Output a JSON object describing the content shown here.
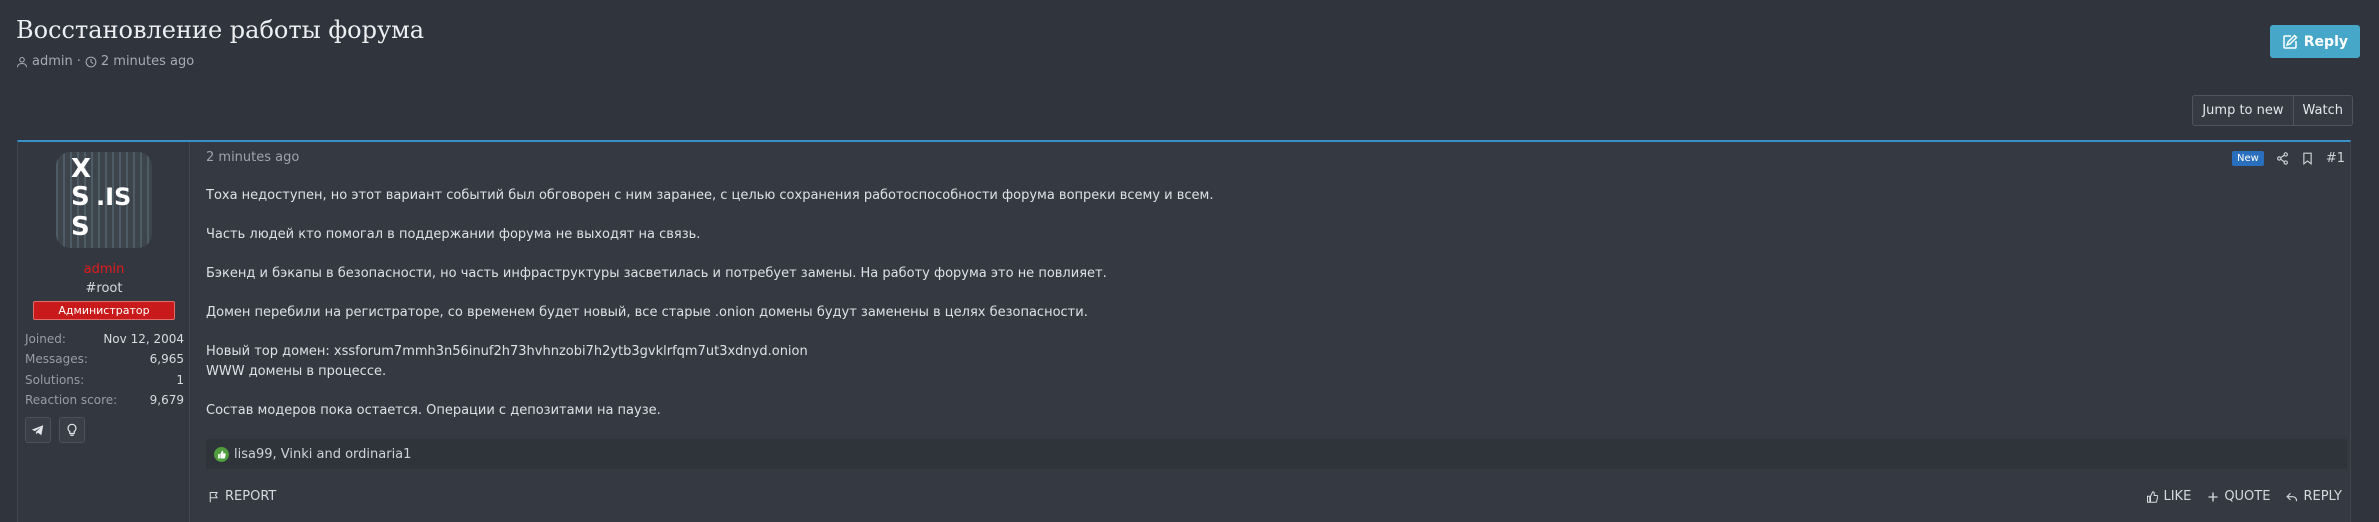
{
  "thread": {
    "title": "Восстановление работы форума",
    "author": "admin",
    "separator": "·",
    "time": "2 minutes ago"
  },
  "buttons": {
    "reply": "Reply",
    "jump_to_new": "Jump to new",
    "watch": "Watch"
  },
  "user": {
    "avatar_glyphs": [
      "X",
      "S",
      ".IS",
      "S"
    ],
    "name": "admin",
    "title": "#root",
    "banner": "Администратор",
    "stats": [
      {
        "label": "Joined:",
        "value": "Nov 12, 2004"
      },
      {
        "label": "Messages:",
        "value": "6,965"
      },
      {
        "label": "Solutions:",
        "value": "1"
      },
      {
        "label": "Reaction score:",
        "value": "9,679"
      }
    ]
  },
  "post": {
    "date": "2 minutes ago",
    "badge": "New",
    "number": "#1",
    "paragraphs": [
      "Тоха недоступен, но этот вариант событий был обговорен с ним заранее, с целью сохранения работоспособности форума вопреки всему и всем.",
      "Часть людей кто помогал в поддержании форума не выходят на связь.",
      "Бэкенд и бэкапы в безопасности, но часть инфраструктуры засветилась и потребует замены. На работу форума это не повлияет.",
      "Домен перебили на регистраторе, со временем будет новый, все старые .onion домены будут заменены в целях безопасности.",
      "Новый тор домен: xssforum7mmh3n56inuf2h73hvhnzobi7h2ytb3gvklrfqm7ut3xdnyd.onion",
      "WWW домены в процессе.",
      "Состав модеров пока остается. Операции с депозитами на паузе."
    ],
    "reactions": "lisa99, Vinki and ordinaria1",
    "report": "REPORT",
    "like": "LIKE",
    "quote": "QUOTE",
    "reply": "REPLY"
  },
  "colors": {
    "background": "#30343c",
    "accent": "#47a7c9",
    "admin_red": "#e2191a",
    "banner_red": "#c81a1a",
    "new_badge": "#2a6fbd",
    "like_green": "#4f9d3c"
  },
  "icons": [
    "user-icon",
    "clock-icon",
    "edit-icon",
    "telegram-icon",
    "lightbulb-icon",
    "share-icon",
    "bookmark-icon",
    "thumbs-up-icon",
    "flag-icon",
    "plus-icon",
    "reply-arrow-icon"
  ]
}
